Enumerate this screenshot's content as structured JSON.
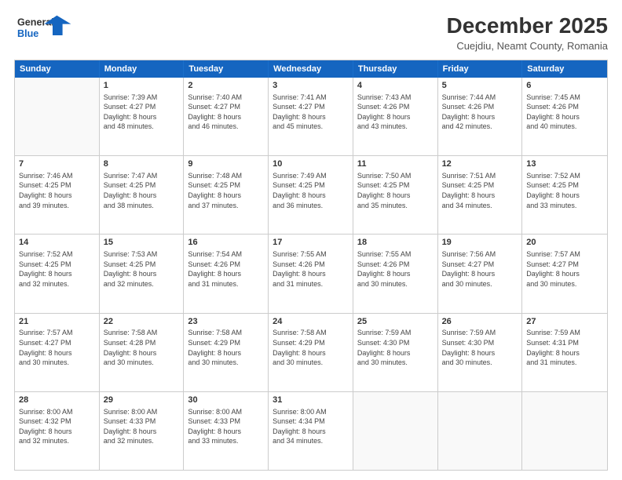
{
  "header": {
    "logo_line1": "General",
    "logo_line2": "Blue",
    "main_title": "December 2025",
    "subtitle": "Cuejdiu, Neamt County, Romania"
  },
  "days_of_week": [
    "Sunday",
    "Monday",
    "Tuesday",
    "Wednesday",
    "Thursday",
    "Friday",
    "Saturday"
  ],
  "weeks": [
    [
      {
        "day": "",
        "info": ""
      },
      {
        "day": "1",
        "info": "Sunrise: 7:39 AM\nSunset: 4:27 PM\nDaylight: 8 hours\nand 48 minutes."
      },
      {
        "day": "2",
        "info": "Sunrise: 7:40 AM\nSunset: 4:27 PM\nDaylight: 8 hours\nand 46 minutes."
      },
      {
        "day": "3",
        "info": "Sunrise: 7:41 AM\nSunset: 4:27 PM\nDaylight: 8 hours\nand 45 minutes."
      },
      {
        "day": "4",
        "info": "Sunrise: 7:43 AM\nSunset: 4:26 PM\nDaylight: 8 hours\nand 43 minutes."
      },
      {
        "day": "5",
        "info": "Sunrise: 7:44 AM\nSunset: 4:26 PM\nDaylight: 8 hours\nand 42 minutes."
      },
      {
        "day": "6",
        "info": "Sunrise: 7:45 AM\nSunset: 4:26 PM\nDaylight: 8 hours\nand 40 minutes."
      }
    ],
    [
      {
        "day": "7",
        "info": "Sunrise: 7:46 AM\nSunset: 4:25 PM\nDaylight: 8 hours\nand 39 minutes."
      },
      {
        "day": "8",
        "info": "Sunrise: 7:47 AM\nSunset: 4:25 PM\nDaylight: 8 hours\nand 38 minutes."
      },
      {
        "day": "9",
        "info": "Sunrise: 7:48 AM\nSunset: 4:25 PM\nDaylight: 8 hours\nand 37 minutes."
      },
      {
        "day": "10",
        "info": "Sunrise: 7:49 AM\nSunset: 4:25 PM\nDaylight: 8 hours\nand 36 minutes."
      },
      {
        "day": "11",
        "info": "Sunrise: 7:50 AM\nSunset: 4:25 PM\nDaylight: 8 hours\nand 35 minutes."
      },
      {
        "day": "12",
        "info": "Sunrise: 7:51 AM\nSunset: 4:25 PM\nDaylight: 8 hours\nand 34 minutes."
      },
      {
        "day": "13",
        "info": "Sunrise: 7:52 AM\nSunset: 4:25 PM\nDaylight: 8 hours\nand 33 minutes."
      }
    ],
    [
      {
        "day": "14",
        "info": "Sunrise: 7:52 AM\nSunset: 4:25 PM\nDaylight: 8 hours\nand 32 minutes."
      },
      {
        "day": "15",
        "info": "Sunrise: 7:53 AM\nSunset: 4:25 PM\nDaylight: 8 hours\nand 32 minutes."
      },
      {
        "day": "16",
        "info": "Sunrise: 7:54 AM\nSunset: 4:26 PM\nDaylight: 8 hours\nand 31 minutes."
      },
      {
        "day": "17",
        "info": "Sunrise: 7:55 AM\nSunset: 4:26 PM\nDaylight: 8 hours\nand 31 minutes."
      },
      {
        "day": "18",
        "info": "Sunrise: 7:55 AM\nSunset: 4:26 PM\nDaylight: 8 hours\nand 30 minutes."
      },
      {
        "day": "19",
        "info": "Sunrise: 7:56 AM\nSunset: 4:27 PM\nDaylight: 8 hours\nand 30 minutes."
      },
      {
        "day": "20",
        "info": "Sunrise: 7:57 AM\nSunset: 4:27 PM\nDaylight: 8 hours\nand 30 minutes."
      }
    ],
    [
      {
        "day": "21",
        "info": "Sunrise: 7:57 AM\nSunset: 4:27 PM\nDaylight: 8 hours\nand 30 minutes."
      },
      {
        "day": "22",
        "info": "Sunrise: 7:58 AM\nSunset: 4:28 PM\nDaylight: 8 hours\nand 30 minutes."
      },
      {
        "day": "23",
        "info": "Sunrise: 7:58 AM\nSunset: 4:29 PM\nDaylight: 8 hours\nand 30 minutes."
      },
      {
        "day": "24",
        "info": "Sunrise: 7:58 AM\nSunset: 4:29 PM\nDaylight: 8 hours\nand 30 minutes."
      },
      {
        "day": "25",
        "info": "Sunrise: 7:59 AM\nSunset: 4:30 PM\nDaylight: 8 hours\nand 30 minutes."
      },
      {
        "day": "26",
        "info": "Sunrise: 7:59 AM\nSunset: 4:30 PM\nDaylight: 8 hours\nand 30 minutes."
      },
      {
        "day": "27",
        "info": "Sunrise: 7:59 AM\nSunset: 4:31 PM\nDaylight: 8 hours\nand 31 minutes."
      }
    ],
    [
      {
        "day": "28",
        "info": "Sunrise: 8:00 AM\nSunset: 4:32 PM\nDaylight: 8 hours\nand 32 minutes."
      },
      {
        "day": "29",
        "info": "Sunrise: 8:00 AM\nSunset: 4:33 PM\nDaylight: 8 hours\nand 32 minutes."
      },
      {
        "day": "30",
        "info": "Sunrise: 8:00 AM\nSunset: 4:33 PM\nDaylight: 8 hours\nand 33 minutes."
      },
      {
        "day": "31",
        "info": "Sunrise: 8:00 AM\nSunset: 4:34 PM\nDaylight: 8 hours\nand 34 minutes."
      },
      {
        "day": "",
        "info": ""
      },
      {
        "day": "",
        "info": ""
      },
      {
        "day": "",
        "info": ""
      }
    ]
  ]
}
